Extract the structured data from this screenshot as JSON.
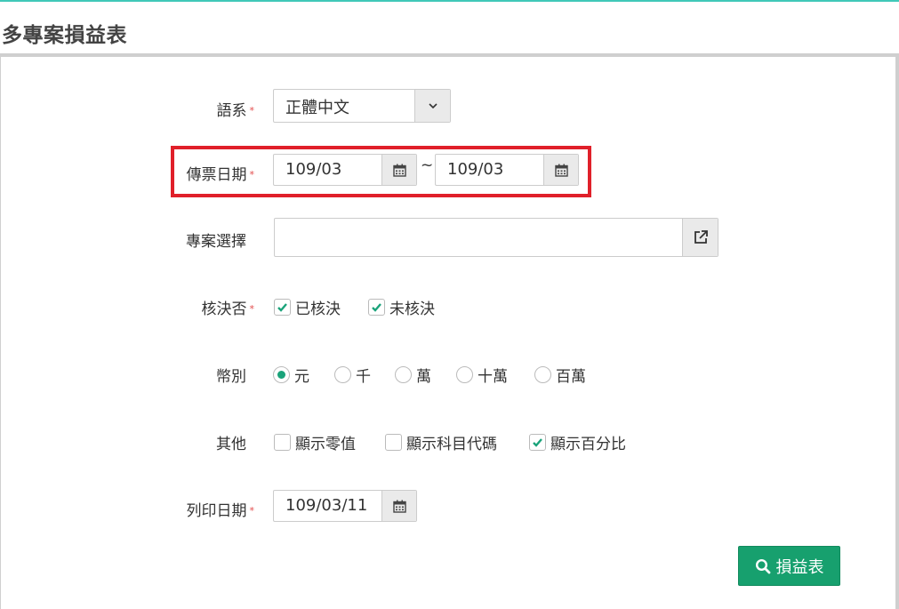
{
  "page": {
    "title": "多專案損益表"
  },
  "form": {
    "language": {
      "label": "語系",
      "required": "*",
      "value": "正體中文"
    },
    "voucher_date": {
      "label": "傳票日期",
      "required": "*",
      "from": "109/03",
      "separator": "~",
      "to": "109/03"
    },
    "project": {
      "label": "專案選擇",
      "value": ""
    },
    "approval": {
      "label": "核決否",
      "required": "*",
      "options": [
        {
          "label": "已核決",
          "checked": true
        },
        {
          "label": "未核決",
          "checked": true
        }
      ]
    },
    "currency": {
      "label": "幣別",
      "options": [
        {
          "label": "元",
          "selected": true
        },
        {
          "label": "千",
          "selected": false
        },
        {
          "label": "萬",
          "selected": false
        },
        {
          "label": "十萬",
          "selected": false
        },
        {
          "label": "百萬",
          "selected": false
        }
      ]
    },
    "other": {
      "label": "其他",
      "options": [
        {
          "label": "顯示零值",
          "checked": false
        },
        {
          "label": "顯示科目代碼",
          "checked": false
        },
        {
          "label": "顯示百分比",
          "checked": true
        }
      ]
    },
    "print_date": {
      "label": "列印日期",
      "required": "*",
      "value": "109/03/11"
    }
  },
  "actions": {
    "submit_label": "損益表"
  },
  "colors": {
    "accent": "#17a06e",
    "highlight": "#e0202a",
    "required": "#e24b4b"
  }
}
